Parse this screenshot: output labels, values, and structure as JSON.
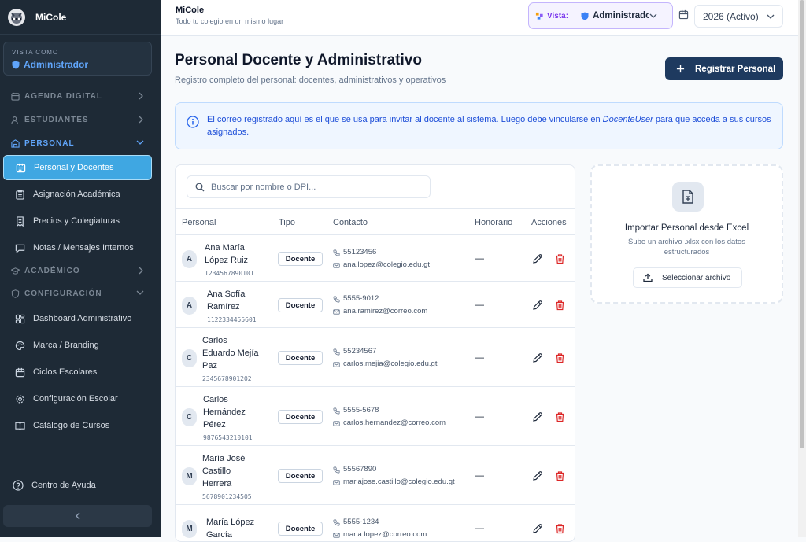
{
  "sidebar": {
    "brand": "MiCole",
    "view_as_caption": "VISTA COMO",
    "view_as_value": "Administrador",
    "sections": [
      {
        "label": "AGENDA DIGITAL"
      },
      {
        "label": "ESTUDIANTES"
      },
      {
        "label": "PERSONAL"
      },
      {
        "label": "ACADÉMICO"
      },
      {
        "label": "CONFIGURACIÓN"
      }
    ],
    "items": [
      {
        "label": "Personal y Docentes"
      },
      {
        "label": "Asignación Académica"
      },
      {
        "label": "Precios y Colegiaturas"
      },
      {
        "label": "Notas / Mensajes Internos"
      },
      {
        "label": "Dashboard Administrativo"
      },
      {
        "label": "Marca / Branding"
      },
      {
        "label": "Ciclos Escolares"
      },
      {
        "label": "Configuración Escolar"
      },
      {
        "label": "Catálogo de Cursos"
      }
    ],
    "help": "Centro de Ayuda"
  },
  "topbar": {
    "title": "MiCole",
    "subtitle": "Todo tu colegio en un mismo lugar",
    "vista_label": "Vista:",
    "vista_value": "Administrador",
    "year": "2026 (Activo)"
  },
  "page": {
    "title": "Personal Docente y Administrativo",
    "subtitle": "Registro completo del personal: docentes, administrativos y operativos",
    "register_button": "Registrar Personal"
  },
  "info": {
    "text_before": "El correo registrado aquí es el que se usa para invitar al docente al sistema. Luego debe vincularse en ",
    "text_em": "DocenteUser",
    "text_after": " para que acceda a sus cursos asignados."
  },
  "table": {
    "search_placeholder": "Buscar por nombre o DPI...",
    "headers": [
      "Personal",
      "Tipo",
      "Contacto",
      "Honorario",
      "Acciones"
    ],
    "rows": [
      {
        "initial": "A",
        "name_lines": [
          "Ana María",
          "López Ruiz"
        ],
        "dpi": "1234567890101",
        "type": "Docente",
        "phone": "55123456",
        "email": "ana.lopez@colegio.edu.gt",
        "fee": "—"
      },
      {
        "initial": "A",
        "name_lines": [
          "Ana Sofía",
          "Ramírez"
        ],
        "dpi": "1122334455601",
        "type": "Docente",
        "phone": "5555-9012",
        "email": "ana.ramirez@correo.com",
        "fee": "—"
      },
      {
        "initial": "C",
        "name_lines": [
          "Carlos",
          "Eduardo Mejía",
          "Paz"
        ],
        "dpi": "2345678901202",
        "type": "Docente",
        "phone": "55234567",
        "email": "carlos.mejia@colegio.edu.gt",
        "fee": "—"
      },
      {
        "initial": "C",
        "name_lines": [
          "Carlos",
          "Hernández",
          "Pérez"
        ],
        "dpi": "9876543210101",
        "type": "Docente",
        "phone": "5555-5678",
        "email": "carlos.hernandez@correo.com",
        "fee": "—"
      },
      {
        "initial": "M",
        "name_lines": [
          "María José",
          "Castillo",
          "Herrera"
        ],
        "dpi": "5678901234505",
        "type": "Docente",
        "phone": "55567890",
        "email": "mariajose.castillo@colegio.edu.gt",
        "fee": "—"
      },
      {
        "initial": "M",
        "name_lines": [
          "María López",
          "García"
        ],
        "dpi": "",
        "type": "Docente",
        "phone": "5555-1234",
        "email": "maria.lopez@correo.com",
        "fee": "—"
      }
    ]
  },
  "import": {
    "title": "Importar Personal desde Excel",
    "subtitle": "Sube un archivo .xlsx con los datos estructurados",
    "button": "Seleccionar archivo"
  },
  "colors": {
    "sidebar_bg": "#1e2a36",
    "active_item": "#3fa7e2",
    "primary_button": "#1e3a5f",
    "delete_icon": "#dc2626"
  }
}
